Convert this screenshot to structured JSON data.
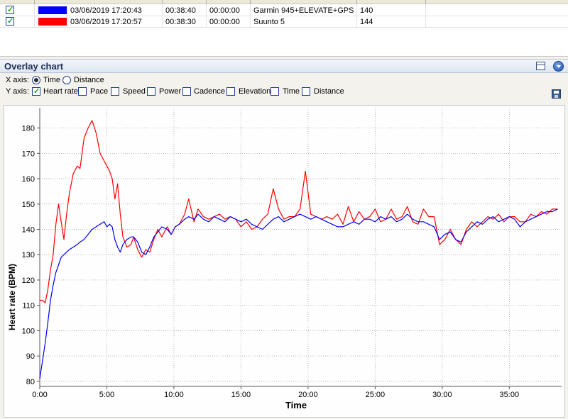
{
  "activities": [
    {
      "checked": true,
      "color": "#0000ff",
      "start": "03/06/2019 17:20:43",
      "duration": "00:38:40",
      "offset": "00:00:00",
      "name": "Garmin 945+ELEVATE+GPS",
      "avg_hr": "140"
    },
    {
      "checked": true,
      "color": "#ff0000",
      "start": "03/06/2019 17:20:57",
      "duration": "00:38:30",
      "offset": "00:00:00",
      "name": "Suunto 5",
      "avg_hr": "144"
    }
  ],
  "panel": {
    "title": "Overlay chart",
    "icons": [
      "window-icon",
      "collapse-icon",
      "save-icon"
    ]
  },
  "x_axis": {
    "label": "X axis:",
    "options": [
      {
        "label": "Time",
        "selected": true
      },
      {
        "label": "Distance",
        "selected": false
      }
    ]
  },
  "y_axis": {
    "label": "Y axis:",
    "options": [
      {
        "label": "Heart rate",
        "checked": true
      },
      {
        "label": "Pace",
        "checked": false
      },
      {
        "label": "Speed",
        "checked": false
      },
      {
        "label": "Power",
        "checked": false
      },
      {
        "label": "Cadence",
        "checked": false
      },
      {
        "label": "Elevation",
        "checked": false
      },
      {
        "label": "Time",
        "checked": false
      },
      {
        "label": "Distance",
        "checked": false
      }
    ]
  },
  "chart_data": {
    "type": "line",
    "xlabel": "Time",
    "ylabel": "Heart rate (BPM)",
    "xlim_minutes": [
      0,
      38.9
    ],
    "ylim": [
      78,
      188
    ],
    "x_ticks": [
      "0:00",
      "5:00",
      "10:00",
      "15:00",
      "20:00",
      "25:00",
      "30:00",
      "35:00"
    ],
    "y_ticks": [
      80,
      90,
      100,
      110,
      120,
      130,
      140,
      150,
      160,
      170,
      180
    ],
    "grid": true,
    "series": [
      {
        "color": "#0000ff",
        "x_minutes": [
          0,
          0.2,
          0.4,
          0.6,
          0.8,
          1.0,
          1.2,
          1.4,
          1.6,
          1.8,
          2.0,
          2.2,
          2.5,
          2.8,
          3.0,
          3.3,
          3.6,
          3.9,
          4.2,
          4.5,
          4.8,
          5.0,
          5.2,
          5.4,
          5.6,
          5.8,
          6.0,
          6.2,
          6.5,
          6.8,
          7.0,
          7.3,
          7.6,
          7.9,
          8.2,
          8.5,
          8.8,
          9.1,
          9.5,
          9.8,
          10.1,
          10.4,
          10.8,
          11.1,
          11.5,
          11.8,
          12.2,
          12.6,
          13.0,
          13.4,
          13.8,
          14.2,
          14.6,
          15.0,
          15.4,
          15.8,
          16.2,
          16.6,
          17.0,
          17.4,
          17.8,
          18.2,
          18.6,
          19.0,
          19.4,
          19.8,
          20.2,
          20.6,
          21.0,
          21.4,
          21.8,
          22.2,
          22.6,
          23.0,
          23.4,
          23.8,
          24.2,
          24.6,
          25.0,
          25.4,
          25.8,
          26.2,
          26.6,
          27.0,
          27.4,
          27.8,
          28.2,
          28.6,
          29.0,
          29.4,
          29.8,
          30.2,
          30.6,
          31.0,
          31.4,
          31.8,
          32.2,
          32.6,
          33.0,
          33.4,
          33.8,
          34.2,
          34.6,
          35.0,
          35.4,
          35.8,
          36.2,
          36.6,
          37.0,
          37.4,
          37.8,
          38.2,
          38.6
        ],
        "y": [
          81,
          88,
          95,
          103,
          112,
          118,
          123,
          126,
          129,
          130,
          131,
          132,
          133,
          134,
          135,
          136,
          138,
          140,
          141,
          142,
          143,
          141,
          142,
          141,
          136,
          133,
          131,
          134,
          136,
          137,
          137,
          135,
          131,
          130,
          133,
          137,
          139,
          141,
          140,
          138,
          141,
          142,
          144,
          145,
          144,
          146,
          144,
          143,
          145,
          144,
          143,
          145,
          144,
          143,
          144,
          142,
          141,
          140,
          142,
          144,
          145,
          143,
          144,
          145,
          146,
          145,
          144,
          145,
          144,
          143,
          142,
          141,
          141,
          142,
          143,
          142,
          144,
          144,
          143,
          145,
          144,
          145,
          143,
          144,
          146,
          144,
          143,
          143,
          142,
          141,
          136,
          138,
          139,
          136,
          135,
          139,
          141,
          143,
          142,
          144,
          145,
          143,
          144,
          145,
          144,
          141,
          143,
          144,
          145,
          146,
          147,
          147,
          148
        ]
      },
      {
        "color": "#ff0000",
        "x_minutes": [
          0,
          0.2,
          0.4,
          0.6,
          0.8,
          1.0,
          1.2,
          1.4,
          1.6,
          1.8,
          2.0,
          2.2,
          2.5,
          2.8,
          3.0,
          3.3,
          3.6,
          3.9,
          4.2,
          4.5,
          4.8,
          5.0,
          5.2,
          5.4,
          5.6,
          5.8,
          6.0,
          6.2,
          6.5,
          6.8,
          7.0,
          7.3,
          7.6,
          7.9,
          8.2,
          8.5,
          8.8,
          9.1,
          9.5,
          9.8,
          10.1,
          10.4,
          10.8,
          11.1,
          11.5,
          11.8,
          12.2,
          12.6,
          13.0,
          13.4,
          13.8,
          14.2,
          14.6,
          15.0,
          15.4,
          15.8,
          16.2,
          16.6,
          17.0,
          17.4,
          17.8,
          18.2,
          18.6,
          19.0,
          19.4,
          19.8,
          20.2,
          20.6,
          21.0,
          21.4,
          21.8,
          22.2,
          22.6,
          23.0,
          23.4,
          23.8,
          24.2,
          24.6,
          25.0,
          25.4,
          25.8,
          26.2,
          26.6,
          27.0,
          27.4,
          27.8,
          28.2,
          28.6,
          29.0,
          29.4,
          29.8,
          30.2,
          30.6,
          31.0,
          31.4,
          31.8,
          32.2,
          32.6,
          33.0,
          33.4,
          33.8,
          34.2,
          34.6,
          35.0,
          35.4,
          35.8,
          36.2,
          36.6,
          37.0,
          37.4,
          37.8,
          38.2,
          38.6
        ],
        "y": [
          112,
          112,
          111,
          116,
          124,
          130,
          142,
          150,
          143,
          136,
          146,
          154,
          162,
          165,
          164,
          176,
          180,
          183,
          178,
          170,
          167,
          165,
          163,
          160,
          152,
          158,
          146,
          137,
          133,
          134,
          137,
          132,
          129,
          132,
          131,
          136,
          140,
          137,
          141,
          138,
          141,
          142,
          146,
          152,
          143,
          148,
          145,
          144,
          145,
          146,
          144,
          145,
          144,
          141,
          143,
          140,
          141,
          144,
          146,
          156,
          148,
          144,
          145,
          145,
          148,
          163,
          146,
          145,
          144,
          145,
          144,
          146,
          142,
          149,
          143,
          147,
          144,
          145,
          148,
          143,
          144,
          148,
          144,
          145,
          149,
          143,
          142,
          148,
          145,
          145,
          134,
          136,
          140,
          136,
          134,
          140,
          143,
          141,
          143,
          145,
          144,
          146,
          143,
          145,
          145,
          143,
          143,
          146,
          145,
          147,
          146,
          148,
          148
        ]
      }
    ]
  }
}
